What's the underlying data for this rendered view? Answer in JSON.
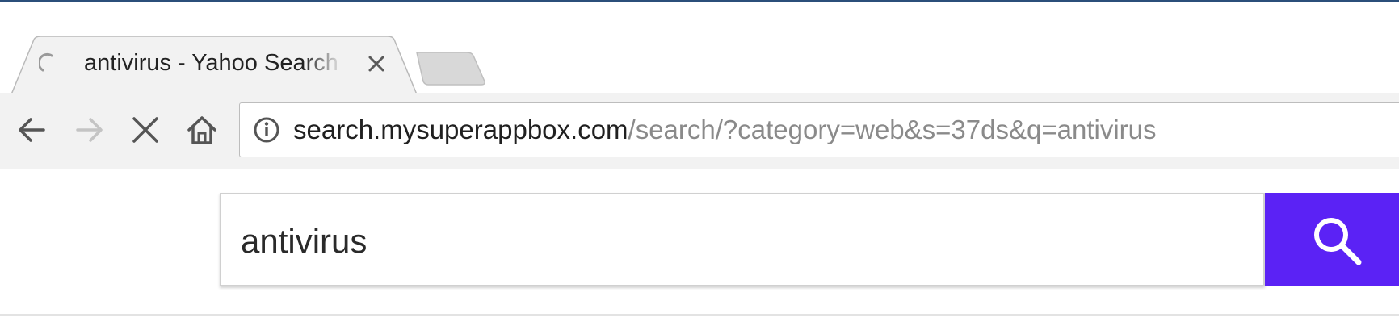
{
  "browser": {
    "tab": {
      "title": "antivirus - Yahoo Search Results",
      "loading": true
    },
    "address_bar": {
      "host": "search.mysuperappbox.com",
      "path": "/search/?category=web&s=37ds&q=antivirus"
    },
    "nav_icons": [
      "back-icon",
      "forward-icon",
      "stop-icon",
      "home-icon"
    ]
  },
  "page": {
    "search": {
      "query": "antivirus",
      "button_color": "#5b22f5"
    }
  }
}
